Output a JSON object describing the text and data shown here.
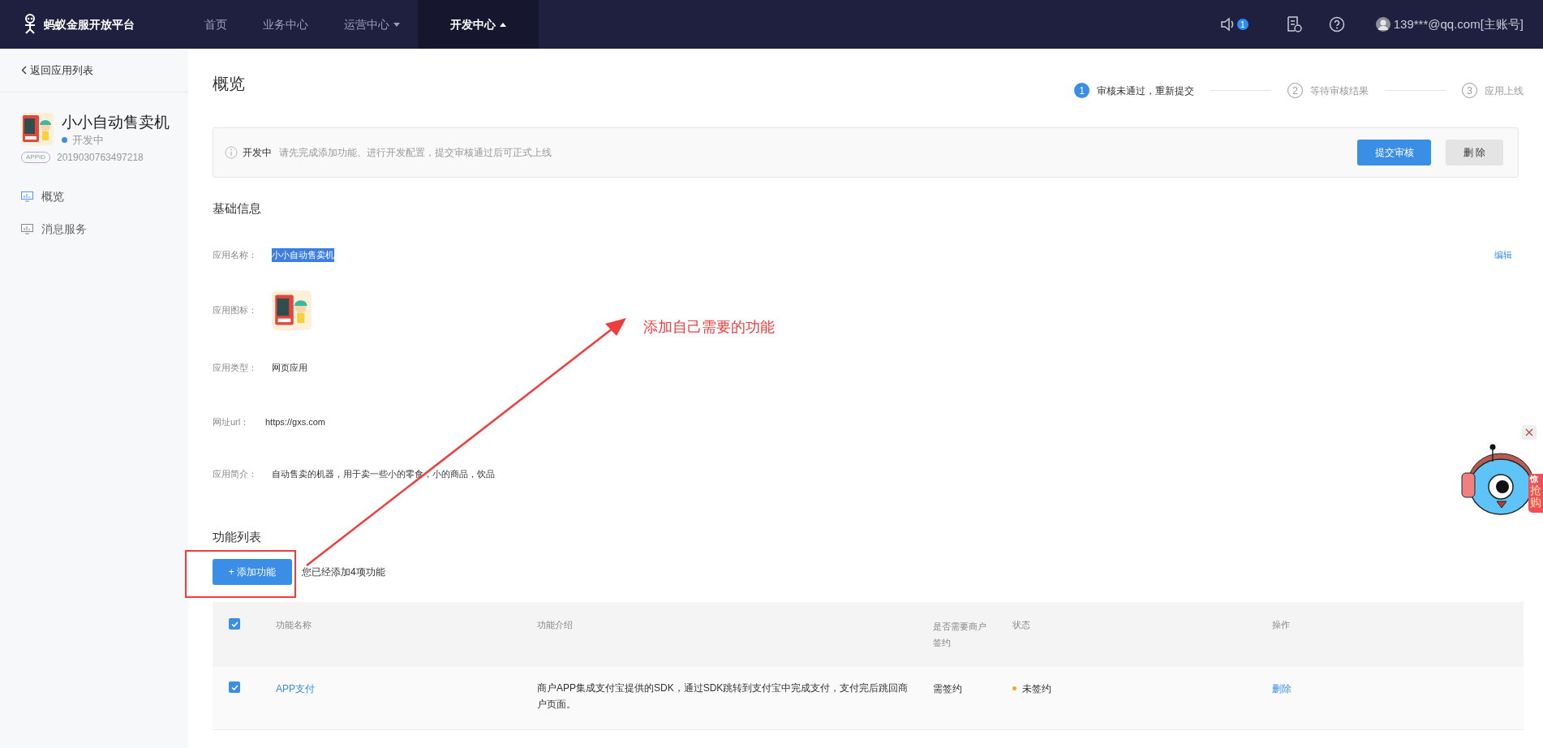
{
  "nav": {
    "logo": "蚂蚁金服开放平台",
    "items": [
      {
        "label": "首页",
        "selected": false,
        "has_menu": false
      },
      {
        "label": "业务中心",
        "selected": false,
        "has_menu": false
      },
      {
        "label": "运营中心",
        "selected": false,
        "has_menu": true,
        "expanded": false
      },
      {
        "label": "开发中心",
        "selected": true,
        "has_menu": true,
        "expanded": true
      }
    ],
    "notifications": "1",
    "user": "139***@qq.com[主账号]"
  },
  "sidebar": {
    "back": "返回应用列表",
    "app": {
      "name": "小小自动售卖机",
      "status": "开发中",
      "color": "#3a8ee6",
      "appid_label": "APPID",
      "appid": "2019030763497218"
    },
    "items": [
      {
        "label": "概览",
        "selected": true
      },
      {
        "label": "消息服务",
        "selected": false
      }
    ]
  },
  "title": "概览",
  "steps": [
    {
      "number": "1",
      "label": "审核未通过，重新提交",
      "selected": true
    },
    {
      "number": "2",
      "label": "等待审核结果",
      "selected": false
    },
    {
      "number": "3",
      "label": "应用上线",
      "selected": false
    }
  ],
  "alert": {
    "status": "开发中",
    "message": "请先完成添加功能、进行开发配置，提交审核通过后可正式上线",
    "buttons": [
      {
        "label": "提交审核",
        "kind": "primary"
      },
      {
        "label": "删 除",
        "kind": "default"
      }
    ]
  },
  "basic_info": {
    "title": "基础信息",
    "edit": "编辑",
    "fields": [
      {
        "label": "应用名称：",
        "kind": "text",
        "value": "小小自动售卖机",
        "highlighted": true
      },
      {
        "label": "应用图标：",
        "kind": "icon"
      },
      {
        "label": "应用类型：",
        "kind": "text",
        "value": "网页应用",
        "highlighted": false
      },
      {
        "label": "网址url：",
        "kind": "text",
        "value": "https://gxs.com",
        "highlighted": false
      },
      {
        "label": "应用简介：",
        "kind": "text",
        "value": "自动售卖的机器，用于卖一些小的零食，小的商品，饮品",
        "highlighted": false
      }
    ]
  },
  "features": {
    "title": "功能列表",
    "add_button": "+ 添加功能",
    "count": "您已经添加4项功能",
    "all_checked": true,
    "columns": [
      "功能名称",
      "功能介绍",
      "是否需要商户签约",
      "状态",
      "操作"
    ],
    "rows": [
      {
        "checked": true,
        "name": "APP支付",
        "description": "商户APP集成支付宝提供的SDK，通过SDK跳转到支付宝中完成支付，支付完后跳回商户页面。",
        "signing": "需签约",
        "status": "未签约",
        "color": "#f5a623",
        "action": "删除"
      }
    ]
  },
  "annotation": {
    "text": "添加自己需要的功能"
  },
  "promo": {
    "badge_top": "惊",
    "badge_text": "抢购"
  }
}
